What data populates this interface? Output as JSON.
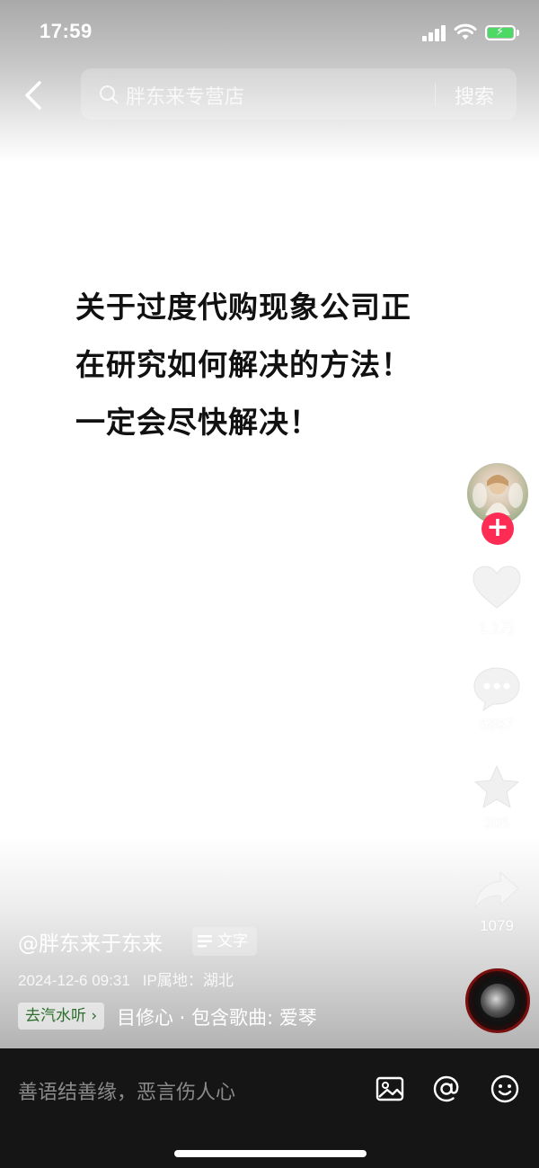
{
  "status_bar": {
    "time": "17:59"
  },
  "header": {
    "search_placeholder": "胖东来专营店",
    "search_button": "搜索"
  },
  "post": {
    "lines": [
      "关于过度代购现象公司正",
      "在研究如何解决的方法！",
      "一定会尽快解决！"
    ]
  },
  "actions": {
    "likes": "1.1万",
    "comments": "5887",
    "favorites": "205",
    "shares": "1079"
  },
  "author": {
    "handle": "@胖东来于东来",
    "tag_label": "文字",
    "date": "2024-12-6 09:31",
    "ip_location": "IP属地：湖北"
  },
  "music": {
    "qishui_label": "去汽水听 ›",
    "info": "目修心 · 包含歌曲: 爱琴"
  },
  "comment_bar": {
    "placeholder": "善语结善缘，恶言伤人心"
  },
  "colors": {
    "follow_red": "#fe2c55",
    "comment_bar_bg": "#151515",
    "battery_green": "#4cd964"
  },
  "icons": [
    "back-icon",
    "search-icon",
    "heart-icon",
    "comment-icon",
    "star-icon",
    "share-icon",
    "image-icon",
    "at-icon",
    "emoji-icon"
  ]
}
